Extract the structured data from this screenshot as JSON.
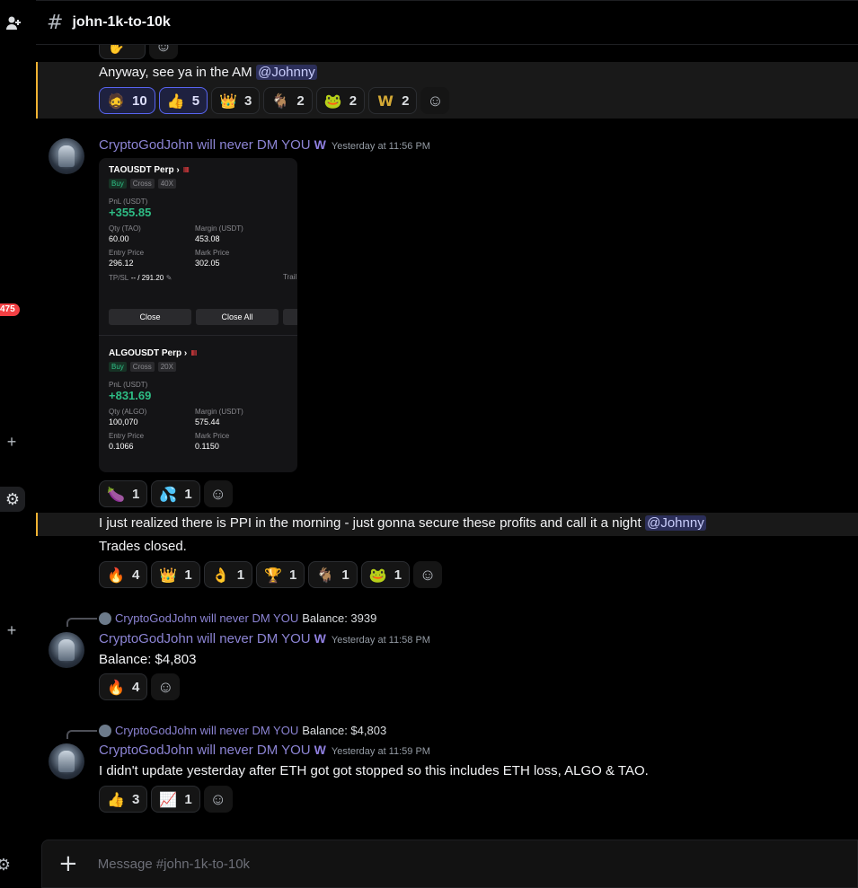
{
  "header": {
    "channel": "john-1k-to-10k"
  },
  "rail": {
    "badge": "475"
  },
  "user": {
    "name": "CryptoGodJohn will never DM YOU"
  },
  "messages": {
    "m1": {
      "text": "Anyway, see ya in the AM",
      "mention": "@Johnny",
      "reactions": [
        {
          "emoji": "🧔",
          "count": "10",
          "active": true
        },
        {
          "emoji": "👍",
          "count": "5",
          "active": true
        },
        {
          "emoji": "👑",
          "count": "3"
        },
        {
          "emoji": "🐐",
          "count": "2"
        },
        {
          "emoji": "🐸",
          "count": "2"
        },
        {
          "emoji": "W",
          "count": "2"
        }
      ]
    },
    "m2": {
      "timestamp": "Yesterday at 11:56 PM",
      "card": {
        "tao": {
          "pair": "TAOUSDT Perp",
          "side": "Buy",
          "mode": "Cross",
          "lev": "40X",
          "pnl_label": "PnL (USDT)",
          "pnl": "+355.85",
          "qty_label": "Qty (TAO)",
          "qty": "60.00",
          "margin_label": "Margin (USDT)",
          "margin": "453.08",
          "entry_label": "Entry Price",
          "entry": "296.12",
          "mark_label": "Mark Price",
          "mark": "302.05",
          "tpsl_label": "TP/SL",
          "tpsl": "-- / 291.20",
          "trail": "Trail",
          "close": "Close",
          "close_all": "Close All"
        },
        "algo": {
          "pair": "ALGOUSDT Perp",
          "side": "Buy",
          "mode": "Cross",
          "lev": "20X",
          "pnl_label": "PnL (USDT)",
          "pnl": "+831.69",
          "qty_label": "Qty (ALGO)",
          "qty": "100,070",
          "margin_label": "Margin (USDT)",
          "margin": "575.44",
          "entry_label": "Entry Price",
          "entry": "0.1066",
          "mark_label": "Mark Price",
          "mark": "0.1150"
        }
      },
      "reactions": [
        {
          "emoji": "🍆",
          "count": "1"
        },
        {
          "emoji": "💦",
          "count": "1"
        }
      ]
    },
    "m3": {
      "text": "I just realized there is PPI in the morning - just gonna secure these profits and call it a night",
      "mention": "@Johnny",
      "text2": "Trades closed.",
      "reactions": [
        {
          "emoji": "🔥",
          "count": "4"
        },
        {
          "emoji": "👑",
          "count": "1"
        },
        {
          "emoji": "👌",
          "count": "1"
        },
        {
          "emoji": "🏆",
          "count": "1"
        },
        {
          "emoji": "🐐",
          "count": "1"
        },
        {
          "emoji": "🐸",
          "count": "1"
        }
      ]
    },
    "m4": {
      "reply_text": "Balance: 3939",
      "timestamp": "Yesterday at 11:58 PM",
      "text": "Balance: $4,803",
      "reactions": [
        {
          "emoji": "🔥",
          "count": "4"
        }
      ]
    },
    "m5": {
      "reply_text": "Balance: $4,803",
      "timestamp": "Yesterday at 11:59 PM",
      "text": "I didn't update yesterday after ETH got got stopped so this includes ETH loss, ALGO & TAO.",
      "reactions": [
        {
          "emoji": "👍",
          "count": "3"
        },
        {
          "emoji": "📈",
          "count": "1"
        }
      ]
    }
  },
  "composer": {
    "placeholder": "Message #john-1k-to-10k"
  }
}
